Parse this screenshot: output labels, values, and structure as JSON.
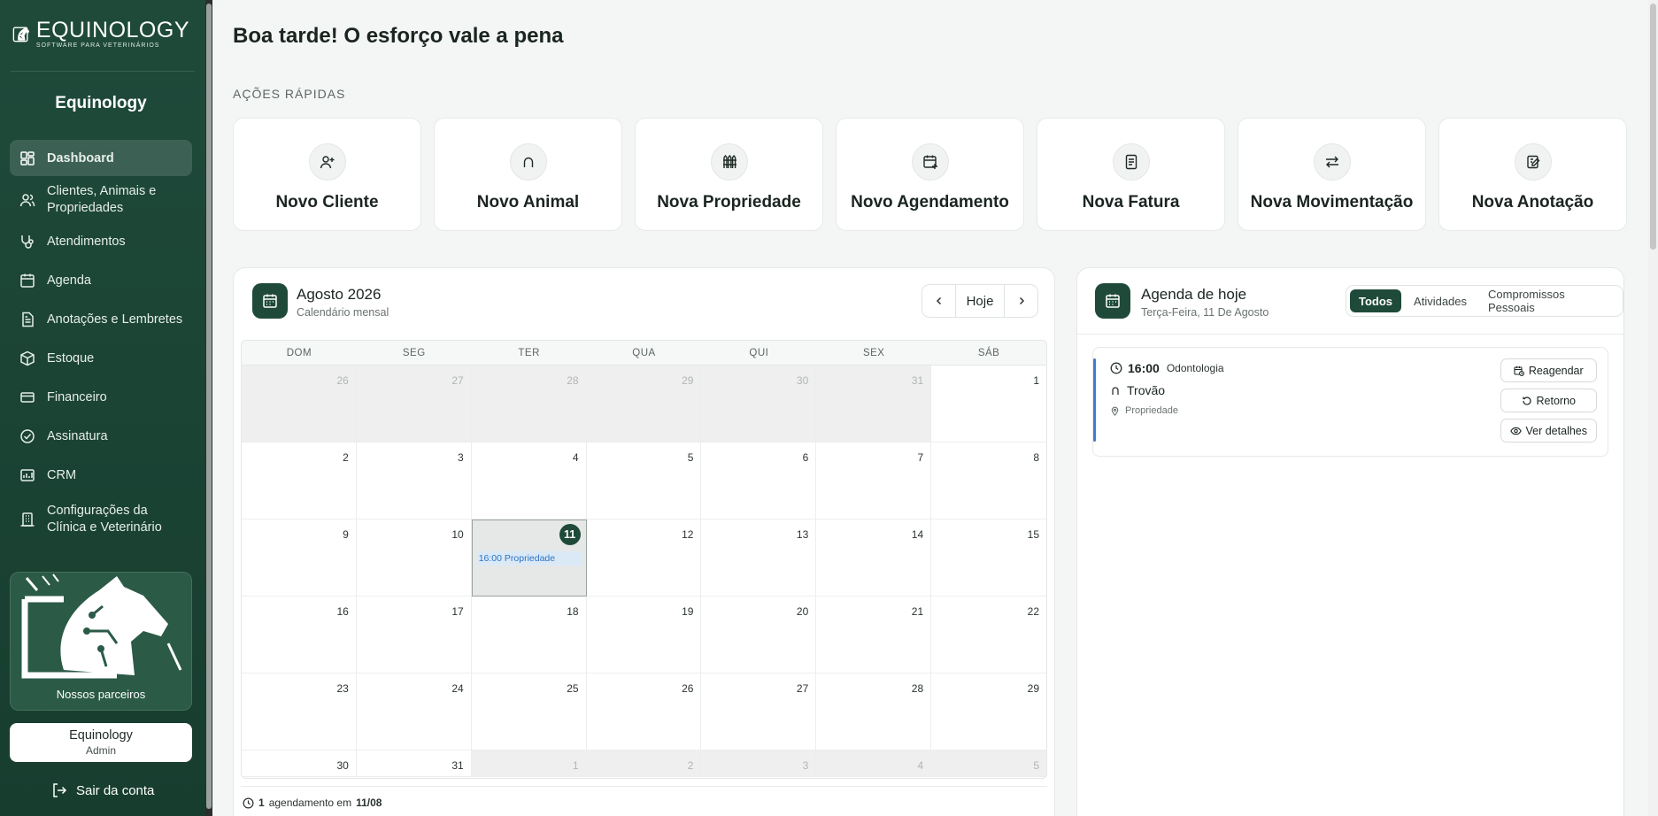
{
  "sidebar": {
    "logo": {
      "name": "EQUINOLOGY",
      "tagline": "SOFTWARE PARA VETERINÁRIOS"
    },
    "org_name": "Equinology",
    "items": [
      {
        "label": "Dashboard",
        "icon": "dashboard-icon",
        "active": true
      },
      {
        "label": "Clientes, Animais e Propriedades",
        "icon": "users-icon",
        "active": false
      },
      {
        "label": "Atendimentos",
        "icon": "stethoscope-icon",
        "active": false
      },
      {
        "label": "Agenda",
        "icon": "calendar-icon",
        "active": false
      },
      {
        "label": "Anotações e Lembretes",
        "icon": "notes-icon",
        "active": false
      },
      {
        "label": "Estoque",
        "icon": "box-icon",
        "active": false
      },
      {
        "label": "Financeiro",
        "icon": "wallet-icon",
        "active": false
      },
      {
        "label": "Assinatura",
        "icon": "check-circle-icon",
        "active": false
      },
      {
        "label": "CRM",
        "icon": "crm-icon",
        "active": false
      },
      {
        "label": "Configurações da Clínica e Veterinário",
        "icon": "building-icon",
        "active": false
      }
    ],
    "partners_label": "Nossos parceiros",
    "user": {
      "name": "Equinology",
      "role": "Admin"
    },
    "logout_label": "Sair da conta"
  },
  "main": {
    "greeting": "Boa tarde! O esforço vale a pena",
    "quick_actions_title": "AÇÕES RÁPIDAS",
    "quick_actions": [
      {
        "label": "Novo Cliente",
        "icon": "user-plus-icon"
      },
      {
        "label": "Novo Animal",
        "icon": "horseshoe-icon"
      },
      {
        "label": "Nova Propriedade",
        "icon": "fence-icon"
      },
      {
        "label": "Novo Agendamento",
        "icon": "calendar-plus-icon"
      },
      {
        "label": "Nova Fatura",
        "icon": "invoice-icon"
      },
      {
        "label": "Nova Movimentação",
        "icon": "transfer-icon"
      },
      {
        "label": "Nova Anotação",
        "icon": "edit-note-icon"
      }
    ]
  },
  "calendar": {
    "title": "Agosto 2026",
    "subtitle": "Calendário mensal",
    "today_label": "Hoje",
    "weekdays": [
      "DOM",
      "SEG",
      "TER",
      "QUA",
      "QUI",
      "SEX",
      "SÁB"
    ],
    "days": [
      {
        "n": "26",
        "muted": true
      },
      {
        "n": "27",
        "muted": true
      },
      {
        "n": "28",
        "muted": true
      },
      {
        "n": "29",
        "muted": true
      },
      {
        "n": "30",
        "muted": true
      },
      {
        "n": "31",
        "muted": true
      },
      {
        "n": "1",
        "muted": false
      },
      {
        "n": "2",
        "muted": false
      },
      {
        "n": "3",
        "muted": false
      },
      {
        "n": "4",
        "muted": false
      },
      {
        "n": "5",
        "muted": false
      },
      {
        "n": "6",
        "muted": false
      },
      {
        "n": "7",
        "muted": false
      },
      {
        "n": "8",
        "muted": false
      },
      {
        "n": "9",
        "muted": false
      },
      {
        "n": "10",
        "muted": false
      },
      {
        "n": "11",
        "muted": false,
        "today": true,
        "event": "16:00 Propriedade"
      },
      {
        "n": "12",
        "muted": false
      },
      {
        "n": "13",
        "muted": false
      },
      {
        "n": "14",
        "muted": false
      },
      {
        "n": "15",
        "muted": false
      },
      {
        "n": "16",
        "muted": false
      },
      {
        "n": "17",
        "muted": false
      },
      {
        "n": "18",
        "muted": false
      },
      {
        "n": "19",
        "muted": false
      },
      {
        "n": "20",
        "muted": false
      },
      {
        "n": "21",
        "muted": false
      },
      {
        "n": "22",
        "muted": false
      },
      {
        "n": "23",
        "muted": false
      },
      {
        "n": "24",
        "muted": false
      },
      {
        "n": "25",
        "muted": false
      },
      {
        "n": "26",
        "muted": false
      },
      {
        "n": "27",
        "muted": false
      },
      {
        "n": "28",
        "muted": false
      },
      {
        "n": "29",
        "muted": false
      },
      {
        "n": "30",
        "muted": false
      },
      {
        "n": "31",
        "muted": false
      },
      {
        "n": "1",
        "muted": true
      },
      {
        "n": "2",
        "muted": true
      },
      {
        "n": "3",
        "muted": true
      },
      {
        "n": "4",
        "muted": true
      },
      {
        "n": "5",
        "muted": true
      }
    ],
    "footer": {
      "count": "1",
      "text": "agendamento em",
      "date": "11/08"
    }
  },
  "agenda": {
    "title": "Agenda de hoje",
    "subtitle": "Terça-Feira, 11 De Agosto",
    "tabs": [
      {
        "label": "Todos",
        "active": true
      },
      {
        "label": "Atividades",
        "active": false
      },
      {
        "label": "Compromissos Pessoais",
        "active": false
      }
    ],
    "items": [
      {
        "time": "16:00",
        "type": "Odontologia",
        "animal": "Trovão",
        "place": "Propriedade",
        "actions": {
          "reschedule": "Reagendar",
          "return": "Retorno",
          "details": "Ver detalhes"
        }
      }
    ]
  },
  "colors": {
    "brand": "#1f4a3a",
    "event": "#3a7fd0",
    "event_bg": "#dbe9f7"
  }
}
